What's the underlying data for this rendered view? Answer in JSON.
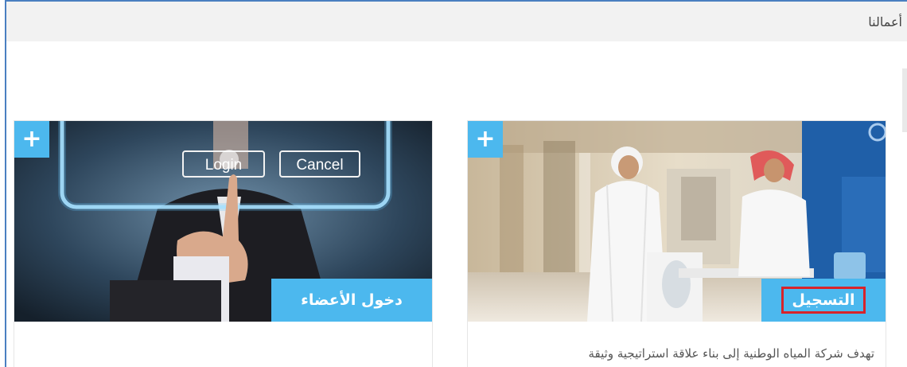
{
  "header": {
    "title": "أعمالنا"
  },
  "cards": [
    {
      "label": "التسجيل",
      "plus": "+",
      "description": "تهدف شركة المياه الوطنية إلى بناء علاقة استراتيجية وثيقة"
    },
    {
      "label": "دخول الأعضاء",
      "plus": "+",
      "overlay": {
        "login": "Login",
        "cancel": "Cancel"
      }
    }
  ],
  "colors": {
    "accent": "#4cb8ee",
    "highlight": "#d8232a",
    "frame": "#4a7fc1"
  }
}
